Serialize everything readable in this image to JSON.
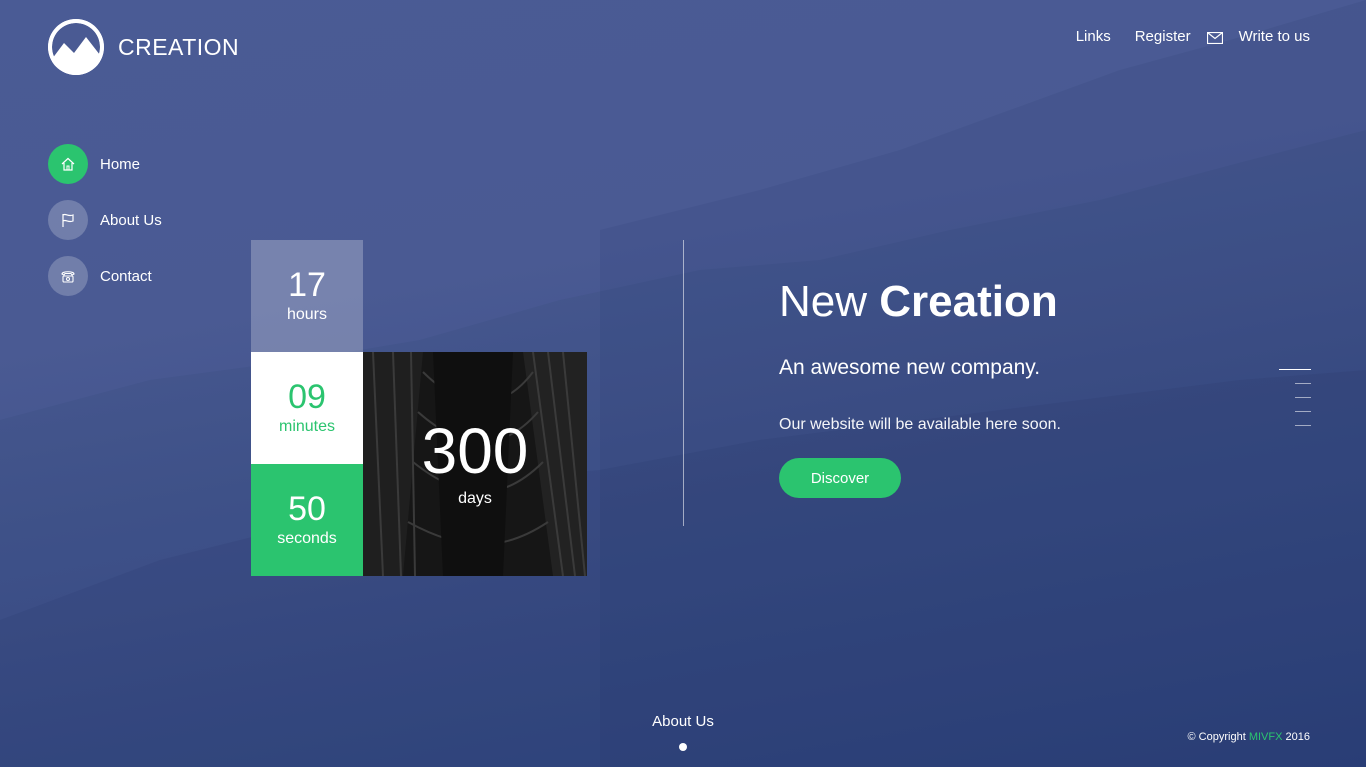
{
  "brand": {
    "name": "CREATION"
  },
  "top_nav": {
    "links": "Links",
    "register": "Register",
    "write": "Write to us"
  },
  "side_menu": [
    {
      "label": "Home",
      "icon": "home-icon",
      "active": true
    },
    {
      "label": "About Us",
      "icon": "flag-icon",
      "active": false
    },
    {
      "label": "Contact",
      "icon": "phone-icon",
      "active": false
    }
  ],
  "countdown": {
    "hours": {
      "value": "17",
      "label": "hours"
    },
    "minutes": {
      "value": "09",
      "label": "minutes"
    },
    "seconds": {
      "value": "50",
      "label": "seconds"
    },
    "days": {
      "value": "300",
      "label": "days"
    }
  },
  "hero": {
    "title_light": "New",
    "title_bold": "Creation",
    "subtitle": "An awesome new company.",
    "text": "Our website will be available here soon.",
    "button": "Discover"
  },
  "bottom": {
    "link": "About Us"
  },
  "footer": {
    "prefix": "© Copyright",
    "brand": "MIVFX",
    "year": "2016"
  },
  "colors": {
    "accent": "#2bc46f",
    "background": "#4a5a93"
  }
}
